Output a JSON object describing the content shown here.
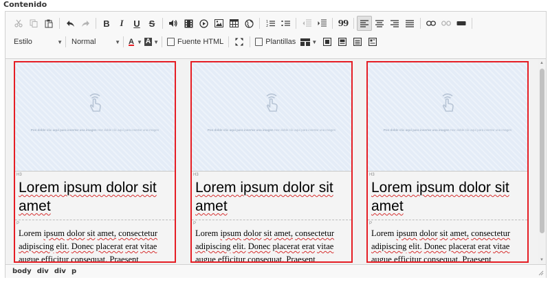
{
  "field_label": "Contenido",
  "toolbar": {
    "style_combo": "Estilo",
    "format_combo": "Normal",
    "font_color_label": "A",
    "bg_color_label": "A",
    "source_label": "Fuente HTML",
    "templates_label": "Plantillas",
    "bold": "B",
    "italic": "I",
    "underline": "U",
    "strike": "S",
    "blockquote": "99"
  },
  "card": {
    "h3_tag": "H3",
    "p_tag": "P",
    "heading": "Lorem ipsum dolor sit amet",
    "image_caption_left": "Pon doble clic aquí para insertar una imagen",
    "image_caption_right": "Haz doble clic aquí para insertar una imagen"
  },
  "cards": [
    {
      "heading": "Lorem ipsum dolor sit amet"
    },
    {
      "heading": "Lorem ipsum dolor sit amet"
    },
    {
      "heading": "Lorem ipsum dolor sit amet"
    }
  ],
  "paragraph": {
    "w1": "Lorem",
    "w2": "ipsum",
    "w3": "dolor",
    "w4": "sit",
    "w5": "amet,",
    "w6": "consectetur",
    "w7": "adipiscing",
    "w8": "elit.",
    "w9": "Donec",
    "w10": "placerat",
    "w11": "erat",
    "w12": "vitae",
    "w13": "augue",
    "w14": "efficitur",
    "w15": "consequat.",
    "w16": "Praesent"
  },
  "statusbar": {
    "path": [
      "body",
      "div",
      "div",
      "p"
    ]
  },
  "colors": {
    "card_border": "#e51c23",
    "spell_error": "#d62f2f",
    "toolbar_bg": "#f8f8f8"
  }
}
